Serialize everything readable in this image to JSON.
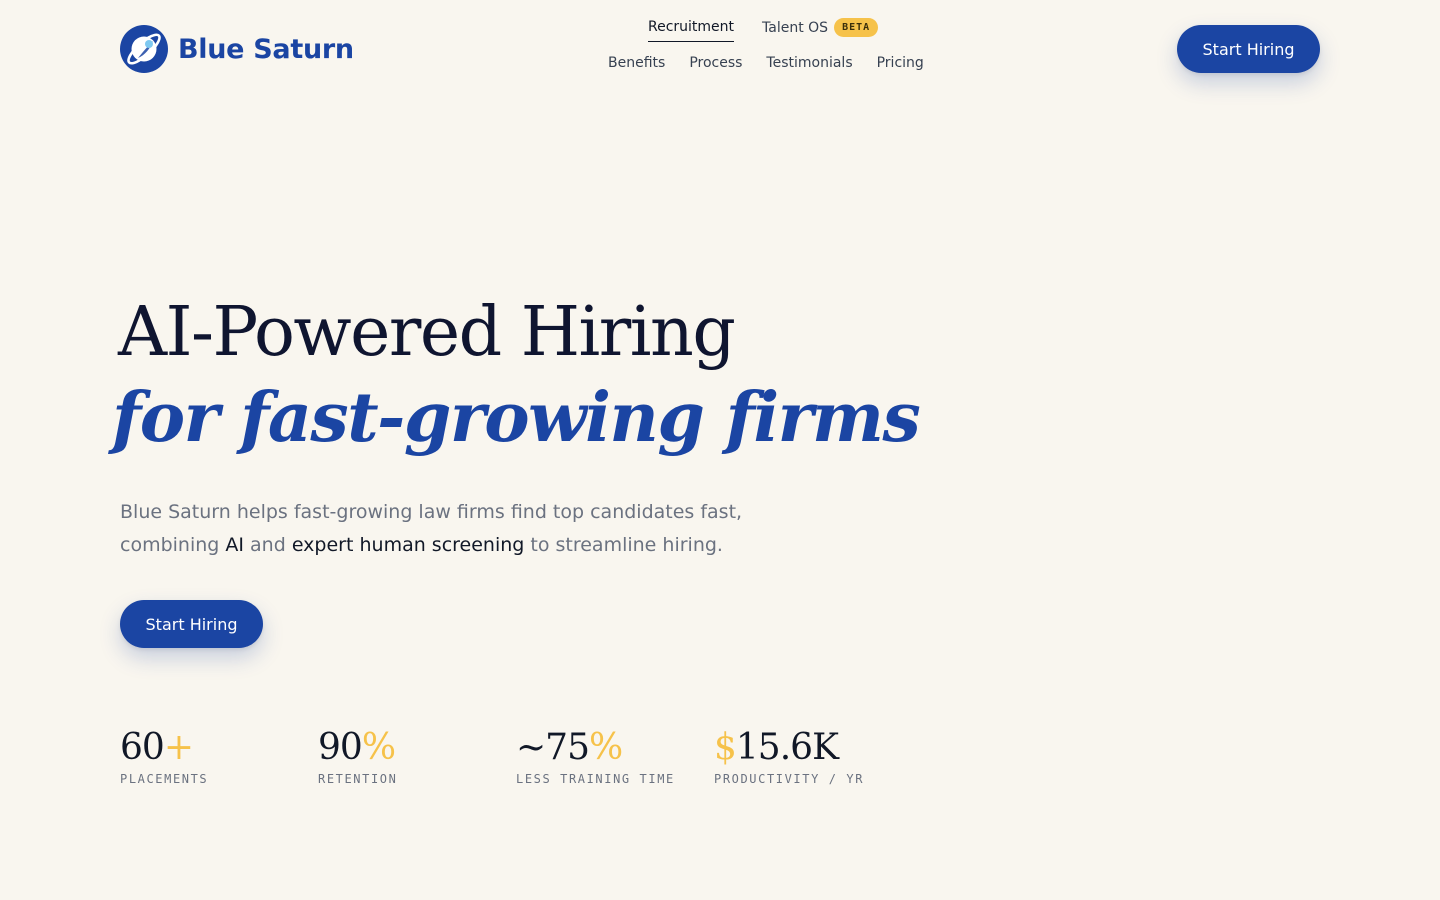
{
  "brand": {
    "name": "Blue Saturn",
    "color": "#1b45a3",
    "accent": "#f6c24a"
  },
  "nav": {
    "top_items": [
      {
        "label": "Recruitment",
        "active": true
      },
      {
        "label": "Talent OS",
        "badge": "BETA"
      }
    ],
    "links": [
      "Benefits",
      "Process",
      "Testimonials",
      "Pricing"
    ],
    "cta_label": "Start Hiring"
  },
  "hero": {
    "title_line1": "AI-Powered Hiring",
    "title_line2": "for fast-growing firms",
    "desc_part1": "Blue Saturn helps fast-growing law firms find top candidates fast, combining ",
    "desc_em1": "AI",
    "desc_part2": " and ",
    "desc_em2": "expert human screening",
    "desc_part3": " to streamline hiring.",
    "cta_label": "Start Hiring"
  },
  "stats": [
    {
      "prefix": "",
      "value": "60",
      "suffix": "+",
      "label": "PLACEMENTS"
    },
    {
      "prefix": "",
      "value": "90",
      "suffix": "%",
      "label": "RETENTION"
    },
    {
      "prefix": "",
      "value": "~75",
      "suffix": "%",
      "label": "LESS TRAINING TIME"
    },
    {
      "prefix": "$",
      "value": "15.6K",
      "suffix": "",
      "label": "PRODUCTIVITY / YR"
    }
  ]
}
